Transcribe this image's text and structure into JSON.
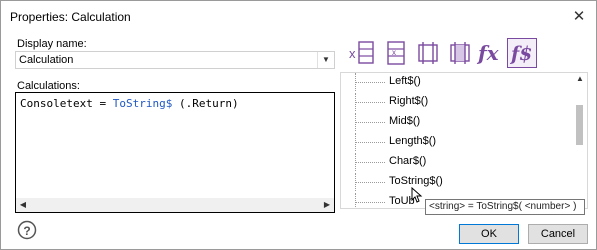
{
  "window": {
    "title": "Properties: Calculation"
  },
  "display_name": {
    "label": "Display name:",
    "value": "Calculation"
  },
  "calculations": {
    "label": "Calculations:",
    "code_var": "Consoletext",
    "code_eq": " = ",
    "code_fn": "ToString$",
    "code_args": " (.Return)"
  },
  "toolbar": {
    "icons": [
      "variable-icon",
      "table-icon",
      "bracket-icon",
      "striped-bracket-icon",
      "fx-icon",
      "fstring-icon"
    ],
    "fx_label": "fx",
    "fs_label": "f$"
  },
  "functions": {
    "items": [
      "Left$()",
      "Right$()",
      "Mid$()",
      "Length$()",
      "Char$()",
      "ToString$()",
      "ToUb"
    ]
  },
  "tooltip": {
    "text": "<string> = ToString$( <number> )"
  },
  "buttons": {
    "ok": "OK",
    "cancel": "Cancel"
  },
  "colors": {
    "accent": "#7a4aa0",
    "function": "#1f57c4"
  }
}
